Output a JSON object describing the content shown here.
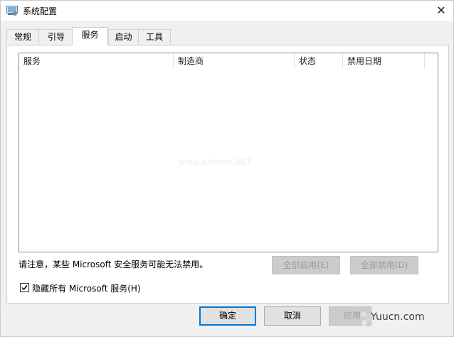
{
  "window": {
    "title": "系统配置",
    "close_glyph": "✕"
  },
  "tabs": [
    {
      "label": "常规",
      "active": false
    },
    {
      "label": "引导",
      "active": false
    },
    {
      "label": "服务",
      "active": true
    },
    {
      "label": "启动",
      "active": false
    },
    {
      "label": "工具",
      "active": false
    }
  ],
  "services_list": {
    "columns": [
      "服务",
      "制造商",
      "状态",
      "禁用日期"
    ],
    "rows": [],
    "watermark": "www.pHome.NET"
  },
  "note": "请注意，某些 Microsoft 安全服务可能无法禁用。",
  "buttons": {
    "enable_all": "全部启用(E)",
    "disable_all": "全部禁用(D)",
    "ok": "确定",
    "cancel": "取消",
    "apply": "应用"
  },
  "hide_ms_checkbox": {
    "label": "隐藏所有 Microsoft 服务(H)",
    "checked": true
  },
  "brand": "Yuucn.com"
}
